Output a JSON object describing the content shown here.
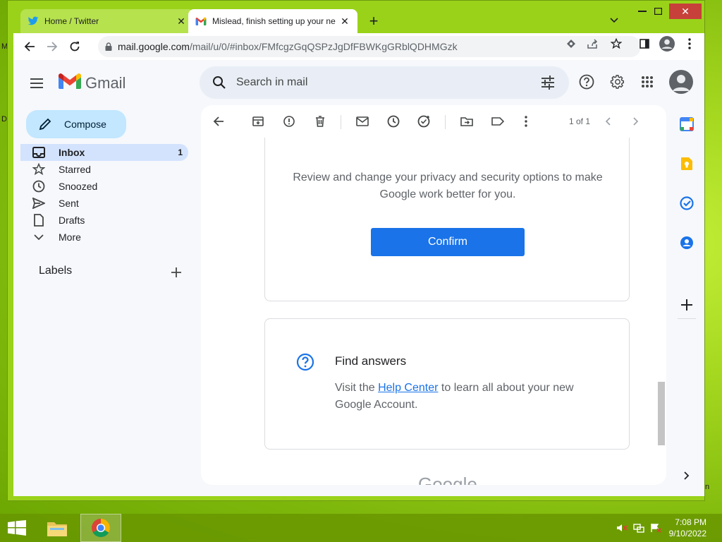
{
  "desktop": {
    "edge_left_1": "M",
    "edge_left_2": "D",
    "edge_right_1": "n"
  },
  "browser": {
    "tabs": [
      {
        "title": "Home / Twitter",
        "icon": "twitter-icon",
        "active": false
      },
      {
        "title": "Mislead, finish setting up your ne",
        "icon": "gmail-icon",
        "active": true
      }
    ],
    "url_host": "mail.google.com",
    "url_path": "/mail/u/0/#inbox/FMfcgzGqQSPzJgDfFBWKgGRblQDHMGzk"
  },
  "gmail": {
    "logo_text": "Gmail",
    "search_placeholder": "Search in mail",
    "compose_label": "Compose",
    "nav": [
      {
        "label": "Inbox",
        "count": "1",
        "icon": "inbox-icon",
        "active": true
      },
      {
        "label": "Starred",
        "icon": "star-icon"
      },
      {
        "label": "Snoozed",
        "icon": "clock-icon"
      },
      {
        "label": "Sent",
        "icon": "send-icon"
      },
      {
        "label": "Drafts",
        "icon": "draft-icon"
      },
      {
        "label": "More",
        "icon": "chevron-down-icon"
      }
    ],
    "labels_heading": "Labels",
    "pager": "1 of 1"
  },
  "email": {
    "review_text": "Review and change your privacy and security options to make Google work better for you.",
    "confirm_label": "Confirm",
    "find_answers_title": "Find answers",
    "find_answers_pre": "Visit the ",
    "help_center_link": "Help Center",
    "find_answers_post": " to learn all about your new Google Account.",
    "footer_brand": "Google"
  },
  "taskbar": {
    "time": "7:08 PM",
    "date": "9/10/2022"
  },
  "colors": {
    "accent_blue": "#1a73e8",
    "gmail_red": "#ea4335",
    "active_nav": "#d3e3fd",
    "compose_bg": "#c2e7ff"
  }
}
